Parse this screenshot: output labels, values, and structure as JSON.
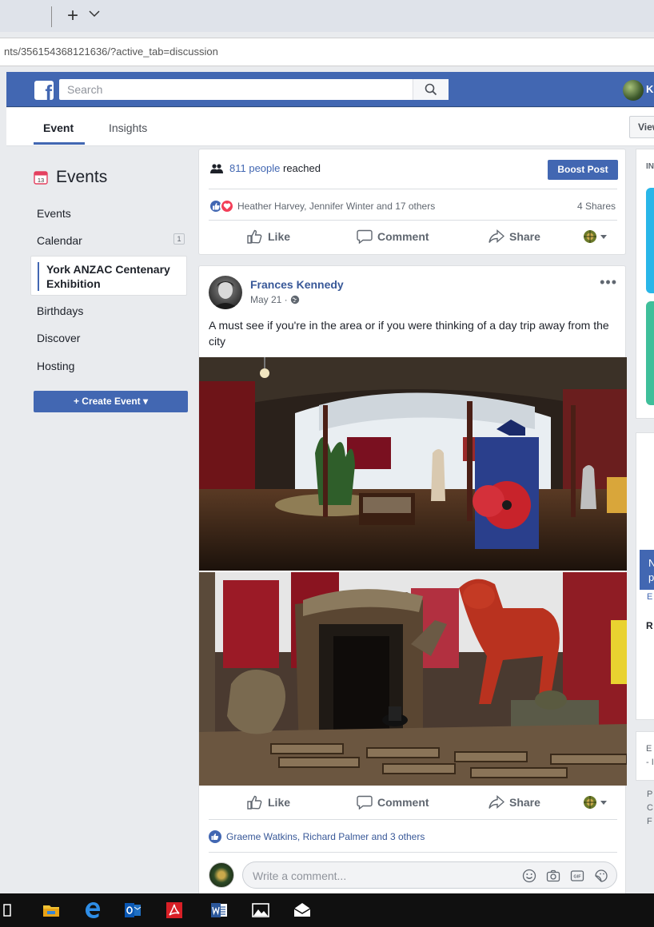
{
  "browser": {
    "new_tab": "+",
    "url": "nts/356154368121636/?active_tab=discussion"
  },
  "fb": {
    "search_placeholder": "Search",
    "profile_initial": "K"
  },
  "subheader": {
    "tab_event": "Event",
    "tab_insights": "Insights",
    "view_button": "View"
  },
  "sidebar": {
    "calendar_day": "13",
    "title": "Events",
    "items": [
      "Events",
      "Calendar",
      "Birthdays",
      "Discover",
      "Hosting"
    ],
    "calendar_badge": "1",
    "selected": "York ANZAC Centenary Exhibition",
    "create_button": "+ Create Event ▾"
  },
  "post1": {
    "reach_count": "811 people",
    "reach_suffix": " reached",
    "boost": "Boost Post",
    "reaction_names": "Heather Harvey, Jennifer Winter and 17 others",
    "shares": "4 Shares",
    "like": "Like",
    "comment": "Comment",
    "share": "Share"
  },
  "post2": {
    "author": "Frances Kennedy",
    "date": "May 21 ·",
    "more": "•••",
    "text": "A must see if you're in the area or if you were thinking of a day trip away from the city",
    "like": "Like",
    "comment": "Comment",
    "share": "Share",
    "likers": "Graeme Watkins, Richard Palmer and 3 others",
    "comment_placeholder": "Write a comment...",
    "gif_label": "GIF"
  },
  "rail": {
    "top_label": "IN",
    "popup_text": "N p",
    "popup_sub": "E",
    "label_r": "R",
    "text_e": "E",
    "text_dash": "- I",
    "footer_lines": [
      "P",
      "C",
      "F"
    ]
  },
  "colors": {
    "fb_blue": "#4267b2",
    "link": "#385898",
    "love_red": "#f33e58",
    "taskbar": "#101010"
  },
  "icons": [
    "tab-chevron-icon",
    "facebook-logo-icon",
    "search-icon",
    "calendar-icon",
    "people-icon",
    "like-reaction-icon",
    "love-reaction-icon",
    "like-icon",
    "comment-icon",
    "share-icon",
    "globe-icon",
    "caret-down-icon",
    "privacy-globe-icon",
    "emoji-icon",
    "camera-icon",
    "gif-icon",
    "sticker-icon",
    "task-view-icon",
    "file-explorer-icon",
    "edge-icon",
    "outlook-icon",
    "acrobat-icon",
    "word-icon",
    "photos-icon",
    "mail-icon"
  ]
}
